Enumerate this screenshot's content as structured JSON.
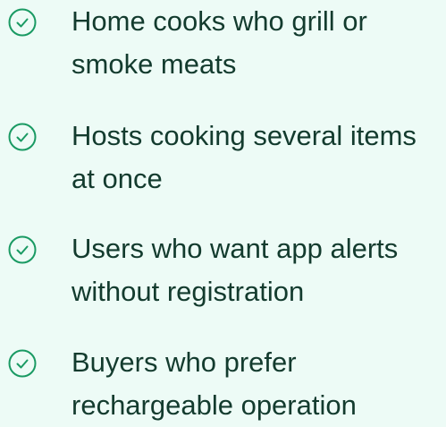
{
  "benefits": {
    "icon": "check-circle-icon",
    "icon_color": "#1a9a63",
    "text_color": "#133b2e",
    "background": "#edfbf6",
    "items": [
      {
        "line1": "Home cooks who grill or",
        "line2": "smoke meats"
      },
      {
        "line1": "Hosts cooking several items",
        "line2": "at once"
      },
      {
        "line1": "Users who want app alerts",
        "line2": "without registration"
      },
      {
        "line1": "Buyers who prefer",
        "line2": "rechargeable operation"
      }
    ]
  }
}
